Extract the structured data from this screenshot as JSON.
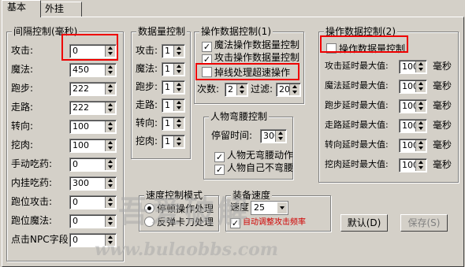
{
  "tabs": [
    "基本",
    "外挂"
  ],
  "interval": {
    "title": "间隔控制(毫秒)",
    "rows": [
      {
        "label": "攻击:",
        "value": "0"
      },
      {
        "label": "魔法:",
        "value": "450"
      },
      {
        "label": "跑步:",
        "value": "222"
      },
      {
        "label": "走路:",
        "value": "222"
      },
      {
        "label": "转向:",
        "value": "100"
      },
      {
        "label": "挖肉:",
        "value": "100"
      },
      {
        "label": "手动吃药:",
        "value": "0"
      },
      {
        "label": "内挂吃药:",
        "value": "300"
      },
      {
        "label": "跑位攻击:",
        "value": "0"
      },
      {
        "label": "跑位魔法:",
        "value": "0"
      },
      {
        "label": "点击NPC字段:",
        "value": "0"
      }
    ]
  },
  "dataqty": {
    "title": "数据量控制",
    "rows": [
      {
        "label": "攻击:",
        "value": "1"
      },
      {
        "label": "魔法:",
        "value": "1"
      },
      {
        "label": "跑步:",
        "value": "1"
      },
      {
        "label": "走路:",
        "value": "1"
      },
      {
        "label": "转向:",
        "value": "1"
      },
      {
        "label": "挖肉:",
        "value": "1"
      }
    ]
  },
  "op1": {
    "title": "操作数据控制(1)",
    "check1": "魔法操作数据量控制",
    "check2": "攻击操作数据量控制",
    "check3": "掉线处理超速操作",
    "times_label": "次数:",
    "times_value": "2",
    "filter_label": "过滤:",
    "filter_value": "200"
  },
  "bend": {
    "title": "人物弯腰控制",
    "stay_label": "停留时间:",
    "stay_value": "300",
    "check1": "人物无弯腰动作",
    "check2": "人物自己不弯腰"
  },
  "op2": {
    "title": "操作数据控制(2)",
    "check": "操作数据量控制",
    "rows": [
      {
        "label": "攻击延时最大值:",
        "value": "100",
        "unit": "毫秒"
      },
      {
        "label": "魔法延时最大值:",
        "value": "100",
        "unit": "毫秒"
      },
      {
        "label": "跑步延时最大值:",
        "value": "100",
        "unit": "毫秒"
      },
      {
        "label": "走路延时最大值:",
        "value": "100",
        "unit": "毫秒"
      },
      {
        "label": "转向延时最大值:",
        "value": "100",
        "unit": "毫秒"
      },
      {
        "label": "挖肉延时最大值:",
        "value": "100",
        "unit": "毫秒"
      }
    ]
  },
  "speedmode": {
    "title": "速度控制模式",
    "radio1": "停顿操作处理",
    "radio2": "反弹卡刀处理"
  },
  "equip": {
    "title": "装备速度",
    "speed_label": "速度",
    "speed_value": "25",
    "check": "自动调整攻击频率"
  },
  "buttons": {
    "default": "默认(D)",
    "save": "保存(S)"
  },
  "watermark": {
    "text1": "吾爱破解",
    "text2": "www.bulaobbs.com"
  }
}
